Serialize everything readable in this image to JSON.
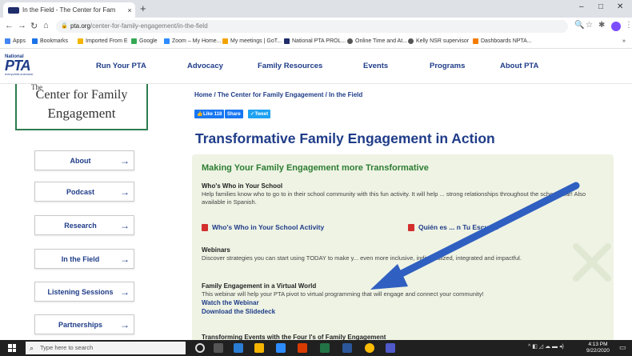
{
  "browser": {
    "tab_title": "In the Field - The Center for Fam",
    "tab_close": "×",
    "new_tab": "+",
    "window_controls": [
      "–",
      "□",
      "✕"
    ],
    "url_domain": "pta.org",
    "url_path": "/center-for-family-engagement/in-the-field",
    "bookmarks": [
      "Apps",
      "Bookmarks",
      "Imported From E",
      "Google",
      "Zoom – My Home...",
      "My meetings | GoT...",
      "National PTA PROL...",
      "Online Time and At...",
      "Kelly NSR supervisor",
      "Dashboards NPTA..."
    ],
    "more_bookmarks": "»"
  },
  "site": {
    "logo": {
      "national": "National",
      "pta": "PTA",
      "tagline": "everychild.onevoice."
    },
    "nav": [
      "Run Your PTA",
      "Advocacy",
      "Family Resources",
      "Events",
      "Programs",
      "About PTA"
    ]
  },
  "sidebar": {
    "brand_the": "The",
    "brand_line1": "Center for Family",
    "brand_line2": "Engagement",
    "items": [
      {
        "label": "About",
        "arrow": "→"
      },
      {
        "label": "Podcast",
        "arrow": "→"
      },
      {
        "label": "Research",
        "arrow": "→"
      },
      {
        "label": "In the Field",
        "arrow": "→"
      },
      {
        "label": "Listening Sessions",
        "arrow": "→"
      },
      {
        "label": "Partnerships",
        "arrow": "→"
      }
    ]
  },
  "main": {
    "breadcrumb": "Home  /  The Center for Family Engagement  /  In the Field",
    "social": {
      "like": "Like 118",
      "share": "Share",
      "tweet": "Tweet"
    },
    "title": "Transformative Family Engagement in Action",
    "panel": {
      "heading": "Making Your Family Engagement more Transformative",
      "s1_title": "Who's Who in Your School",
      "s1_text": "Help families know who to go to in their school community with this fun activity. It will help ... strong relationships throughout the school year! Also available in Spanish.",
      "pdf1": "Who's Who in Your School Activity",
      "pdf2": "Quién es ... n Tu Escuela",
      "s2_title": "Webinars",
      "s2_text": "Discover strategies you can start using TODAY to make y... even more inclusive, individualized, integrated and impactful.",
      "s3_title": "Family Engagement in a Virtual World",
      "s3_text": "This webinar will help your PTA pivot to virtual programming that will engage and connect your community!",
      "link1": "Watch the Webinar",
      "link2": "Download the Slidedeck",
      "s4_title": "Transforming Events with the Four I's of Family Engagement"
    }
  },
  "taskbar": {
    "search_placeholder": "Type here to search",
    "time": "4:13 PM",
    "date": "9/22/2020"
  },
  "colors": {
    "brand_blue": "#1f3c88",
    "brand_green": "#2e7d32",
    "panel_bg": "#eef3e4",
    "arrow_blue": "#2f5fc0"
  }
}
